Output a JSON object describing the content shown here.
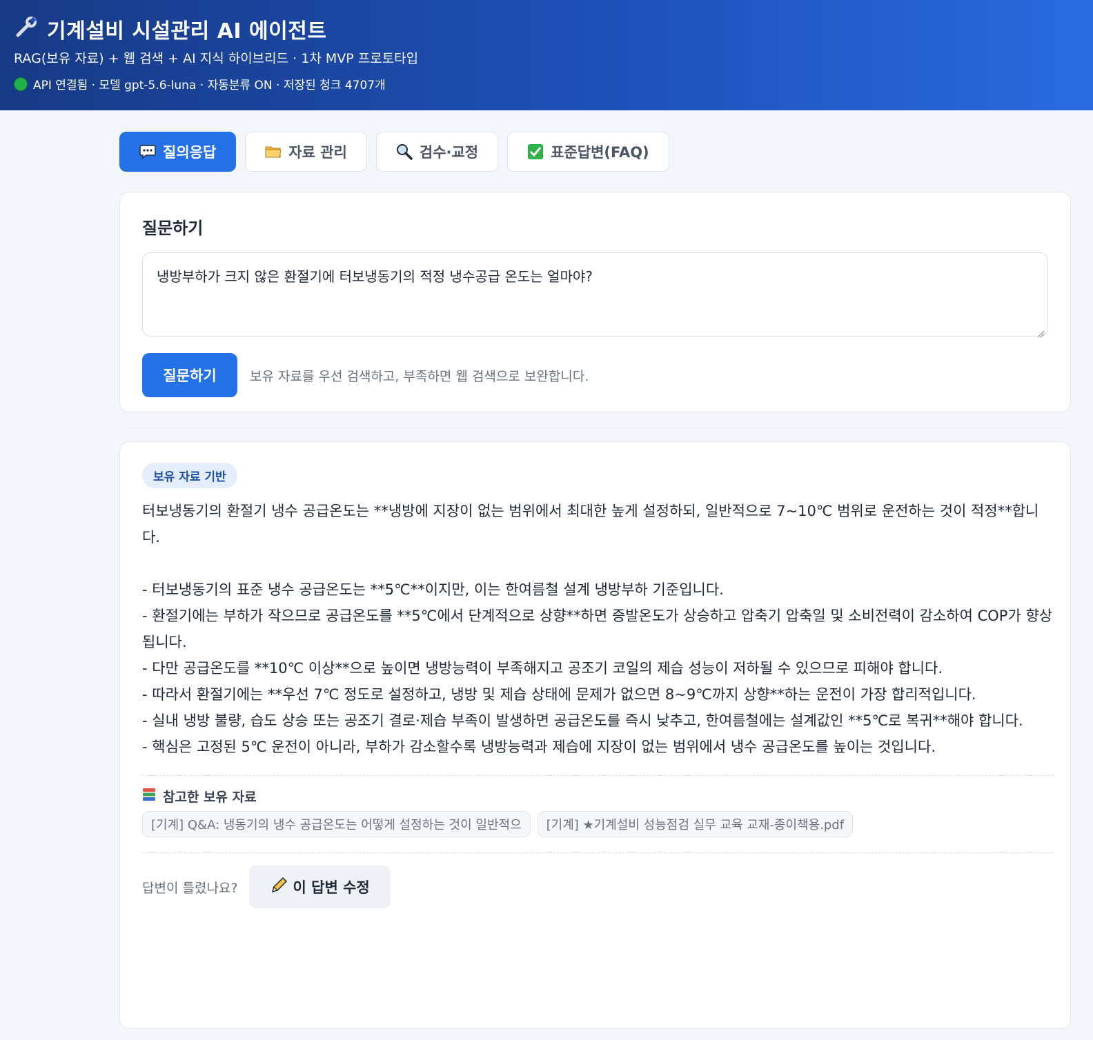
{
  "header": {
    "title": "기계설비 시설관리 AI 에이전트",
    "subtitle": "RAG(보유 자료) + 웹 검색 + AI 지식 하이브리드 · 1차 MVP 프로토타입",
    "status": "API 연결됨 · 모델 gpt-5.6-luna · 자동분류 ON · 저장된 청크 4707개",
    "icon": "wrench-icon"
  },
  "tabs": [
    {
      "label": "질의응답",
      "icon": "speech-bubble-icon",
      "active": true
    },
    {
      "label": "자료 관리",
      "icon": "folder-icon",
      "active": false
    },
    {
      "label": "검수·교정",
      "icon": "magnifier-icon",
      "active": false
    },
    {
      "label": "표준답변(FAQ)",
      "icon": "checkbox-icon",
      "active": false
    }
  ],
  "ask": {
    "title": "질문하기",
    "question": "냉방부하가 크지 않은 환절기에 터보냉동기의 적정 냉수공급 온도는 얼마야?",
    "button_label": "질문하기",
    "hint": "보유 자료를 우선 검색하고, 부족하면 웹 검색으로 보완합니다."
  },
  "answer": {
    "badge": "보유 자료 기반",
    "text": "터보냉동기의 환절기 냉수 공급온도는 **냉방에 지장이 없는 범위에서 최대한 높게 설정하되, 일반적으로 7~10℃ 범위로 운전하는 것이 적정**합니다.\n\n- 터보냉동기의 표준 냉수 공급온도는 **5℃**이지만, 이는 한여름철 설계 냉방부하 기준입니다.\n- 환절기에는 부하가 작으므로 공급온도를 **5℃에서 단계적으로 상향**하면 증발온도가 상승하고 압축기 압축일 및 소비전력이 감소하여 COP가 향상됩니다.\n- 다만 공급온도를 **10℃ 이상**으로 높이면 냉방능력이 부족해지고 공조기 코일의 제습 성능이 저하될 수 있으므로 피해야 합니다.\n- 따라서 환절기에는 **우선 7℃ 정도로 설정하고, 냉방 및 제습 상태에 문제가 없으면 8~9℃까지 상향**하는 운전이 가장 합리적입니다.\n- 실내 냉방 불량, 습도 상승 또는 공조기 결로·제습 부족이 발생하면 공급온도를 즉시 낮추고, 한여름철에는 설계값인 **5℃로 복귀**해야 합니다.\n- 핵심은 고정된 5℃ 운전이 아니라, 부하가 감소할수록 냉방능력과 제습에 지장이 없는 범위에서 냉수 공급온도를 높이는 것입니다.",
    "references_title": "참고한 보유 자료",
    "references": [
      "[기계] Q&A: 냉동기의 냉수 공급온도는 어떻게 설정하는 것이 일반적으",
      "[기계] ★기계설비 성능점검 실무 교육 교재-종이책용.pdf"
    ],
    "feedback_question": "답변이 틀렸나요?",
    "edit_button_label": "이 답변 수정"
  },
  "colors": {
    "primary": "#2470e6",
    "header_start": "#173a86",
    "header_end": "#2a6ae0",
    "status_ok": "#22b14c",
    "badge_bg": "#e3edfb"
  }
}
